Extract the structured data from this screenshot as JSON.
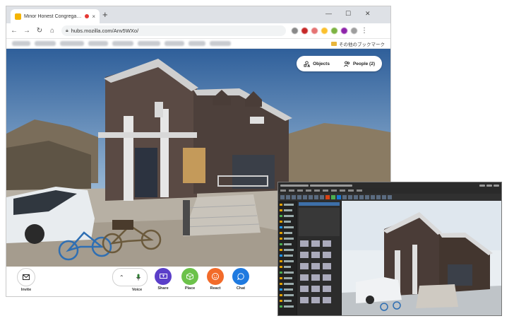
{
  "browser": {
    "tab": {
      "title": "Minor Honest Congregation",
      "favicon": "hubs-favicon",
      "close": "×"
    },
    "newtab": "+",
    "window_controls": {
      "minimize": "—",
      "maximize": "☐",
      "close": "✕"
    },
    "nav": {
      "back": "←",
      "forward": "→",
      "reload": "↻",
      "home": "⌂"
    },
    "url": "hubs.mozilla.com/Anv5WXo/",
    "bookmarks_other": "その他のブックマーク"
  },
  "hubs": {
    "objects_label": "Objects",
    "people_label": "People (2)",
    "invite_label": "Invite",
    "voice_label": "Voice",
    "share_label": "Share",
    "place_label": "Place",
    "react_label": "React",
    "chat_label": "Chat",
    "colors": {
      "share": "#5b3fc9",
      "place": "#6cc24a",
      "react": "#f26b2a",
      "chat": "#1f7ae0"
    }
  }
}
